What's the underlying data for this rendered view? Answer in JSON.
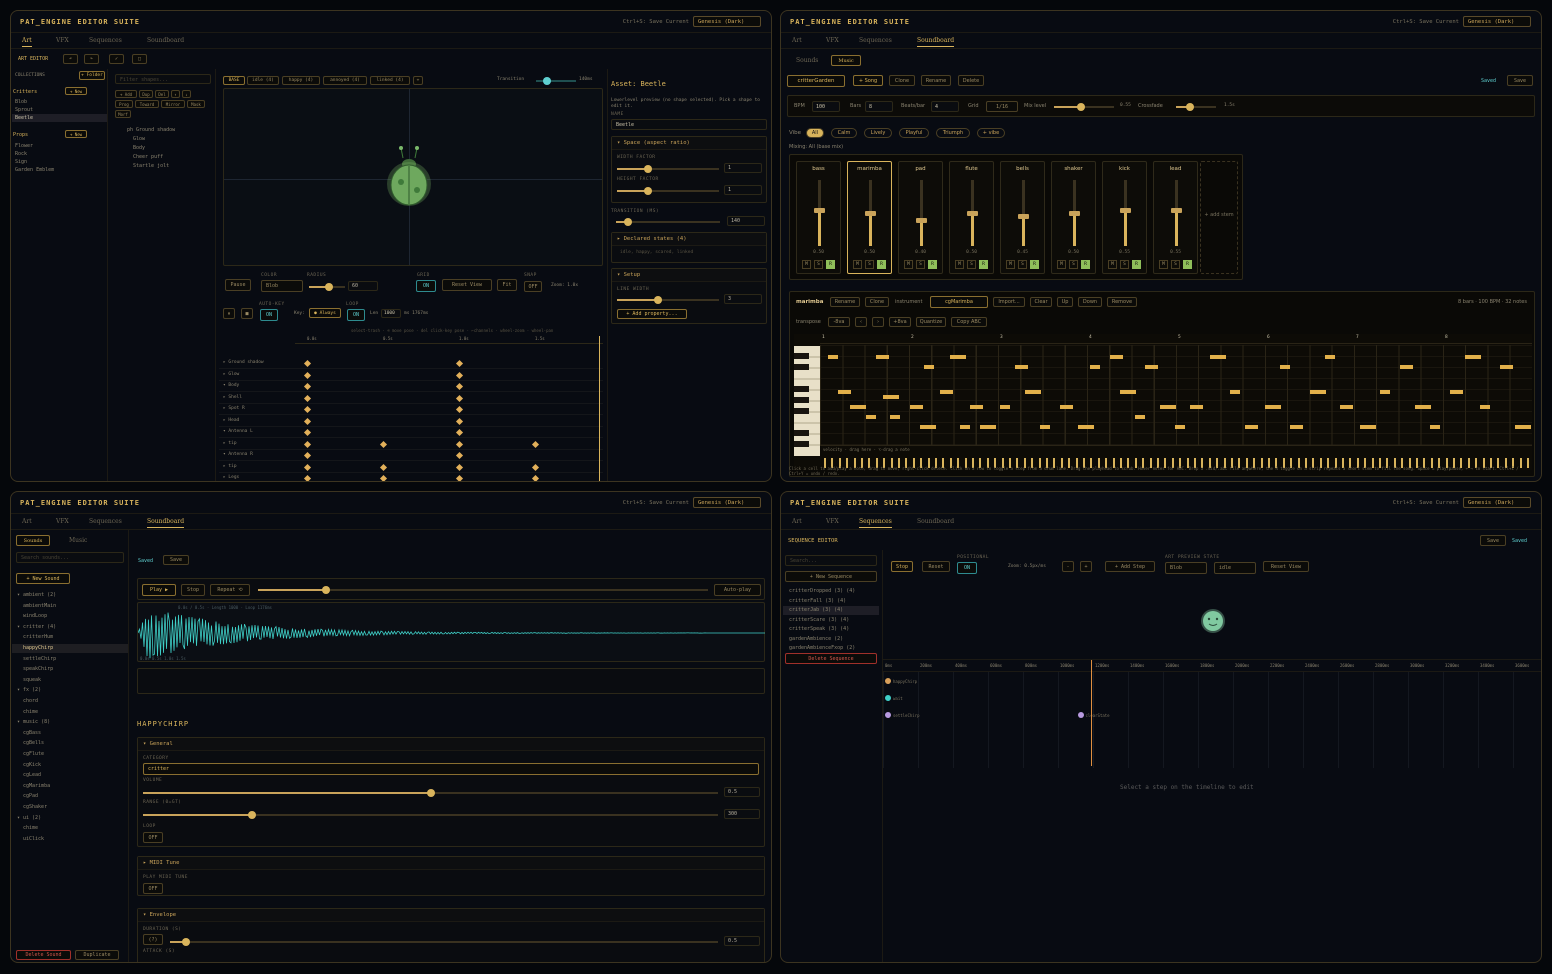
{
  "app": {
    "title": "PAT_ENGINE EDITOR SUITE",
    "save_hint": "Ctrl+S: Save Current",
    "theme": "Genesis (Dark)",
    "tabs": [
      "Art",
      "VFX",
      "Sequences",
      "Soundboard"
    ]
  },
  "art": {
    "header": "ART EDITOR",
    "collections": "COLLECTIONS",
    "add_folder": "+ Folder",
    "filter_placeholder": "Filter shapes...",
    "groups": [
      {
        "name": "Critters",
        "add": "+ New",
        "items": [
          "Blob",
          "Sprout",
          "Beetle"
        ]
      },
      {
        "name": "Props",
        "add": "+ New",
        "items": [
          "Flower",
          "Rock",
          "Sign",
          "Garden Emblem"
        ]
      }
    ],
    "shape_tools": [
      "+ Add",
      "Dup",
      "Del",
      "↑",
      "↓",
      "Prog",
      "Toward",
      "Mirror",
      "Mask",
      "Morf"
    ],
    "layers": [
      "ph Ground shadow",
      "Glow",
      "Body",
      "Cheer puff",
      "Startle jolt"
    ],
    "states": [
      "BASE",
      "idle (4)",
      "happy (4)",
      "annoyed (4)",
      "linked (4)",
      "+"
    ],
    "transition": "Transition",
    "transition_val": "140ms",
    "asset_title": "Asset: Beetle",
    "asset_hint": "Lowerlevel preview (no shape selected). Pick a shape to edit it.",
    "name_label": "NAME",
    "name_val": "Beetle",
    "space_title": "▾ Space (aspect ratio)",
    "width_factor": "WIDTH FACTOR",
    "width_val": "1",
    "height_factor": "HEIGHT FACTOR",
    "height_val": "1",
    "trans_label": "TRANSITION (MS)",
    "trans_val": "140",
    "declared_title": "▸ Declared states (4)",
    "declared_list": "idle, happy, scared, linked",
    "setup_title": "▾ Setup",
    "line_width": "LINE WIDTH",
    "line_val": "3",
    "add_prop": "+ Add property...",
    "controls": {
      "pause": "Pause",
      "color": "COLOR",
      "color_val": "Blob",
      "radius": "RADIUS",
      "radius_val": "60",
      "grid": "GRID",
      "grid_on": "ON",
      "reset": "Reset View",
      "fit": "Fit",
      "snap": "SNAP",
      "snap_off": "OFF",
      "zoom": "Zoom: 1.0x"
    },
    "autokey": "AUTO-KEY",
    "autokey_on": "ON",
    "key": "Key:",
    "always": "● Always",
    "loop": "LOOP",
    "loop_on": "ON",
    "len": "Len",
    "len_val": "1000",
    "len_ms": "ms 1767ms",
    "timeline_hint": "select-trash · ⌫ move pose · del click-key pose · ←channels · wheel-zoom · wheel-pan",
    "ticks": [
      "0.0s",
      "0.5s",
      "1.0s",
      "1.5s"
    ],
    "tracks": [
      "▸ Ground shadow",
      "▸ Glow",
      "▾ Body",
      "▸ Shell",
      "▸ Spot R",
      "▸ Head",
      "▾ Antenna L",
      "▸ tip",
      "▾ Antenna R",
      "▸ tip",
      "▸ Legs"
    ]
  },
  "music": {
    "sub_tabs": [
      "Sounds",
      "Music"
    ],
    "song": "critterGarden",
    "add_song": "+ Song",
    "clone": "Clone",
    "rename": "Rename",
    "delete": "Delete",
    "saved": "Saved",
    "save": "Save",
    "bpm": "BPM",
    "bpm_val": "100",
    "bars": "Bars",
    "bars_val": "8",
    "beats": "Beats/bar",
    "beats_val": "4",
    "grid": "Grid",
    "grid_val": "1/16",
    "mix": "Mix level",
    "mix_val": "0.55",
    "crossfade": "Crossfade",
    "cross_val": "1.5s",
    "vibe": "Vibe",
    "vibes": [
      "All",
      "Calm",
      "Lively",
      "Playful",
      "Triumph",
      "+ vibe"
    ],
    "mixing": "Mixing: All (base mix)",
    "channels": [
      {
        "name": "bass",
        "val": "0.50",
        "level": 0.55
      },
      {
        "name": "marimba",
        "val": "0.50",
        "level": 0.5
      },
      {
        "name": "pad",
        "val": "0.40",
        "level": 0.4
      },
      {
        "name": "flute",
        "val": "0.50",
        "level": 0.5
      },
      {
        "name": "bells",
        "val": "0.45",
        "level": 0.45
      },
      {
        "name": "shaker",
        "val": "0.50",
        "level": 0.5
      },
      {
        "name": "kick",
        "val": "0.55",
        "level": 0.55
      },
      {
        "name": "lead",
        "val": "0.55",
        "level": 0.55
      }
    ],
    "add_stem": "+ add stem",
    "editor": {
      "inst": "marimba",
      "rename": "Rename",
      "clone": "Clone",
      "instrument": "instrument",
      "inst_val": "cgMarimba",
      "import": "Import...",
      "clear": "Clear",
      "up": "Up",
      "down": "Down",
      "remove": "Remove",
      "info": "8 bars · 100 BPM · 32 notes",
      "transpose": "transpose",
      "t_buttons": [
        "-8va",
        "‹",
        "›",
        "+8va",
        "Quantize",
        "Copy ABC"
      ],
      "bar_nums": [
        "1",
        "2",
        "3",
        "4",
        "5",
        "6",
        "7",
        "8"
      ],
      "hint": "Click a cell to add/play a note, drag to move, right-click delete. Click on a row to toggle a step from a drum lane. Drag the playhead to scrub. Hover notes for ABC. Drop a .mid/.abc file anywhere; the R toggle on a strip repeats a short stem to fill the song. Space = play/pause, ← → to start. Ctrl+Z / Ctrl+Y = undo / redo.",
      "vel": "velocity · drag here · ⌥-drag a note"
    }
  },
  "sounds": {
    "sub_tabs": [
      "Sounds",
      "Music"
    ],
    "search": "Search sounds...",
    "new_sound": "+ New Sound",
    "saved": "Saved",
    "save": "Save",
    "tree": [
      [
        "▾ ambient (2)",
        0
      ],
      [
        "ambientMain",
        1
      ],
      [
        "windLoop",
        1
      ],
      [
        "▾ critter (4)",
        0
      ],
      [
        "critterHum",
        1
      ],
      [
        "happyChirp",
        1
      ],
      [
        "settleChirp",
        1
      ],
      [
        "speakChirp",
        1
      ],
      [
        "squeak",
        1
      ],
      [
        "▾ fx (2)",
        0
      ],
      [
        "chord",
        1
      ],
      [
        "chime",
        1
      ],
      [
        "▾ music (8)",
        0
      ],
      [
        "cgBass",
        1
      ],
      [
        "cgBells",
        1
      ],
      [
        "cgFlute",
        1
      ],
      [
        "cgKick",
        1
      ],
      [
        "cgLead",
        1
      ],
      [
        "cgMarimba",
        1
      ],
      [
        "cgPad",
        1
      ],
      [
        "cgShaker",
        1
      ],
      [
        "▾ ui (2)",
        0
      ],
      [
        "chime",
        1
      ],
      [
        "uiClick",
        1
      ]
    ],
    "play": "Play ▶",
    "stop": "Stop",
    "repeat": "Repeat ⟲",
    "autoplay": "Auto-play",
    "wave_info": "0.0s / 0.5s · Length 1000 · Loop 1176ms",
    "wave_foot": "0.0s  0.5s  1.0s  1.5s",
    "title": "HAPPYCHIRP",
    "general": "▾ General",
    "category": "CATEGORY",
    "cat_val": "critter",
    "volume": "VOLUME",
    "vol_val": "0.5",
    "range": "RANGE (0=GT)",
    "range_val": "300",
    "loop": "LOOP",
    "loop_off": "OFF",
    "midi": "▸ MIDI Tune",
    "midi_label": "PLAY MIDI TUNE",
    "midi_off": "OFF",
    "envelope": "▾ Envelope",
    "duration": "DURATION (S)",
    "dur_val": "0.5",
    "attack": "ATTACK (S)",
    "delete": "Delete Sound",
    "duplicate": "Duplicate"
  },
  "seq": {
    "header": "SEQUENCE EDITOR",
    "save": "Save",
    "saved": "Saved",
    "search": "Search...",
    "new": "+ New Sequence",
    "list": [
      "critterDropped (3) (4)",
      "critterFall (3) (4)",
      "critterJab (3) (4)",
      "critterScare (3) (4)",
      "critterSpeak (3) (4)",
      "gardenAmbience (2)",
      "gardenAmbienceFxop (2)"
    ],
    "delete": "Delete Sequence",
    "stop": "Stop",
    "reset": "Reset",
    "positional": "POSITIONAL",
    "pos_on": "ON",
    "zoom": "Zoom: 0.5px/ms",
    "minus": "-",
    "plus": "+",
    "add_step": "+ Add Step",
    "preview": "ART PREVIEW STATE",
    "prev_blob": "Blob",
    "prev_idle": "idle",
    "reset_view": "Reset View",
    "ticks": [
      "0ms",
      "200ms",
      "400ms",
      "600ms",
      "800ms",
      "1000ms",
      "1200ms",
      "1400ms",
      "1600ms",
      "1800ms",
      "2000ms",
      "2200ms",
      "2400ms",
      "2600ms",
      "2800ms",
      "3000ms",
      "3200ms",
      "3400ms",
      "3600ms"
    ],
    "steps": [
      {
        "label": "happyChirp",
        "ms": 0
      },
      {
        "label": "wait",
        "ms": 0
      },
      {
        "label": "settleChirp",
        "ms": 0
      },
      {
        "label": "clearState",
        "ms": 1100
      }
    ],
    "empty": "Select a step on the timeline to edit"
  }
}
